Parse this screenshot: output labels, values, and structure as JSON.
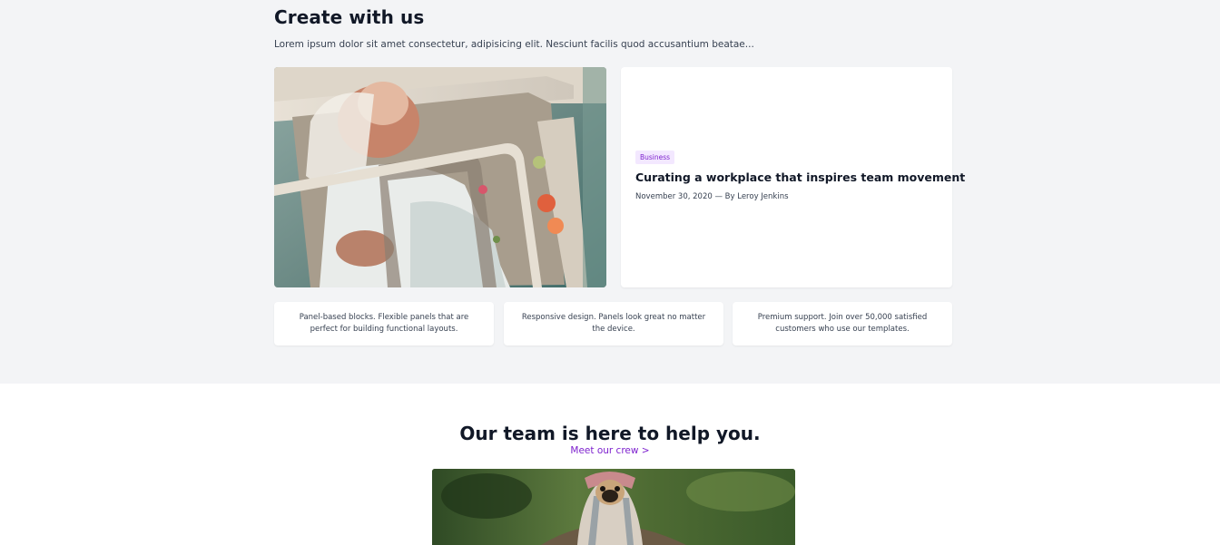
{
  "section": {
    "title": "Create with us",
    "subtitle": "Lorem ipsum dolor sit amet consectetur, adipisicing elit. Nesciunt facilis quod accusantium beatae..."
  },
  "featured_post": {
    "category": "Business",
    "title": "Curating a workplace that inspires team movement",
    "meta": "November 30, 2020 — By Leroy Jenkins",
    "image_icon": "photo-icon"
  },
  "features": [
    {
      "text": "Panel-based blocks. Flexible panels that are perfect for building functional layouts."
    },
    {
      "text": "Responsive design. Panels look great no matter the device."
    },
    {
      "text": "Premium support. Join over 50,000 satisfied customers who use our templates."
    }
  ],
  "team": {
    "title": "Our team is here to help you.",
    "link_label": "Meet our crew >",
    "image_icon": "photo-icon"
  },
  "colors": {
    "accent": "#7e22ce",
    "badge_bg": "#f3e8ff",
    "page_bg": "#f3f4f6",
    "card_bg": "#ffffff",
    "text_dark": "#111827"
  }
}
